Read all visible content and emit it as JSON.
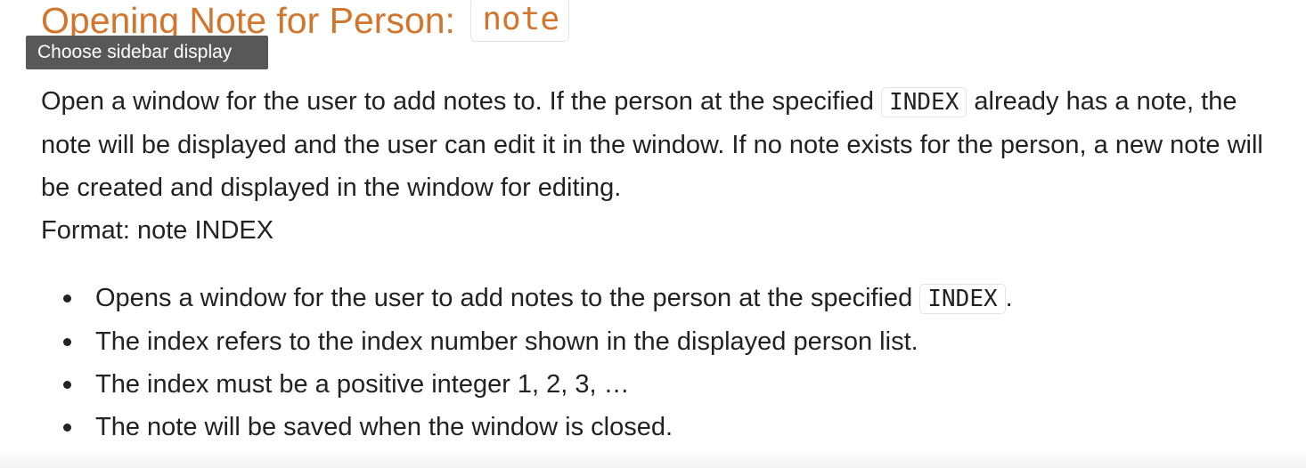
{
  "section": {
    "title_prefix": "Opening Note for Person: ",
    "title_code": "note"
  },
  "tooltip": {
    "text": "Choose sidebar display"
  },
  "description": {
    "part1": "Open a window for the user to add notes to. If the person at the specified ",
    "code1": "INDEX",
    "part2": " already has a note, the note will be displayed and the user can edit it in the window. If no note exists for the person, a new note will be created and displayed in the window for editing.",
    "format": "Format: note INDEX"
  },
  "bullets": {
    "item0_text": "Opens a window for the user to add notes to the person at the specified ",
    "item0_code": "INDEX",
    "item0_suffix": ".",
    "item1": "The index refers to the index number shown in the displayed person list.",
    "item2": "The index must be a positive integer 1, 2, 3, …",
    "item3": "The note will be saved when the window is closed."
  },
  "colors": {
    "heading": "#d2762e",
    "tooltip_bg": "#585858",
    "text": "#222222",
    "code_border": "#e4e4e4"
  }
}
